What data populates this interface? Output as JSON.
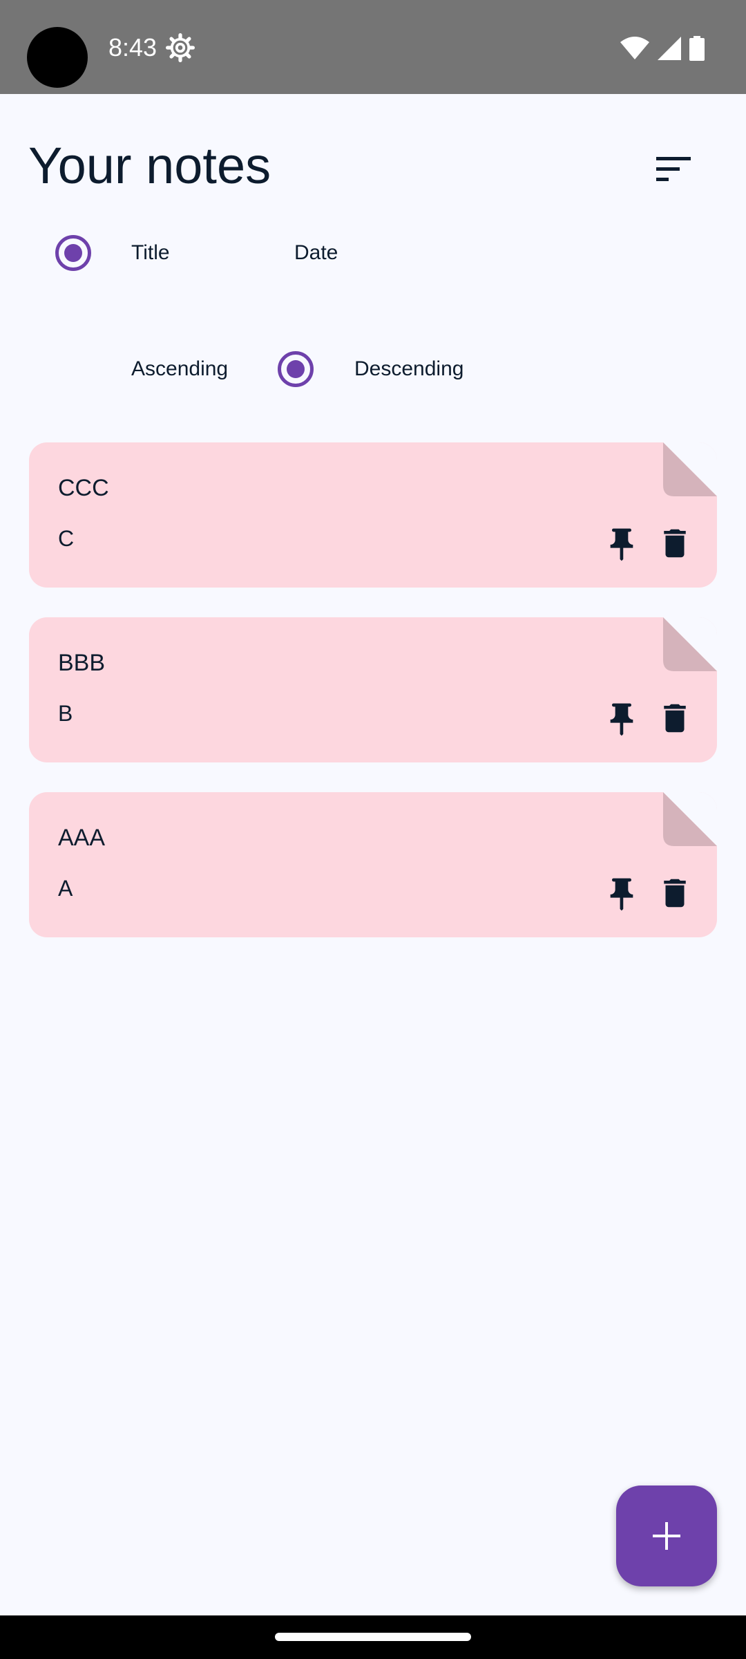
{
  "status_bar": {
    "time": "8:43",
    "icons": [
      "settings-icon",
      "wifi-icon",
      "signal-icon",
      "battery-icon"
    ]
  },
  "header": {
    "title": "Your notes",
    "sort_icon": "sort-icon"
  },
  "sort_options": {
    "order_by": [
      {
        "label": "Title",
        "selected": true
      },
      {
        "label": "Date",
        "selected": false
      }
    ],
    "direction": [
      {
        "label": "Ascending",
        "selected": false
      },
      {
        "label": "Descending",
        "selected": true
      }
    ]
  },
  "notes": [
    {
      "title": "CCC",
      "body": "C"
    },
    {
      "title": "BBB",
      "body": "B"
    },
    {
      "title": "AAA",
      "body": "A"
    }
  ],
  "colors": {
    "accent": "#6e41ab",
    "note_background": "#fdd7df",
    "note_fold": "#d5b3bb",
    "page_background": "#f8f9ff",
    "text": "#0d1c2e"
  },
  "fab": {
    "icon": "plus-icon"
  }
}
